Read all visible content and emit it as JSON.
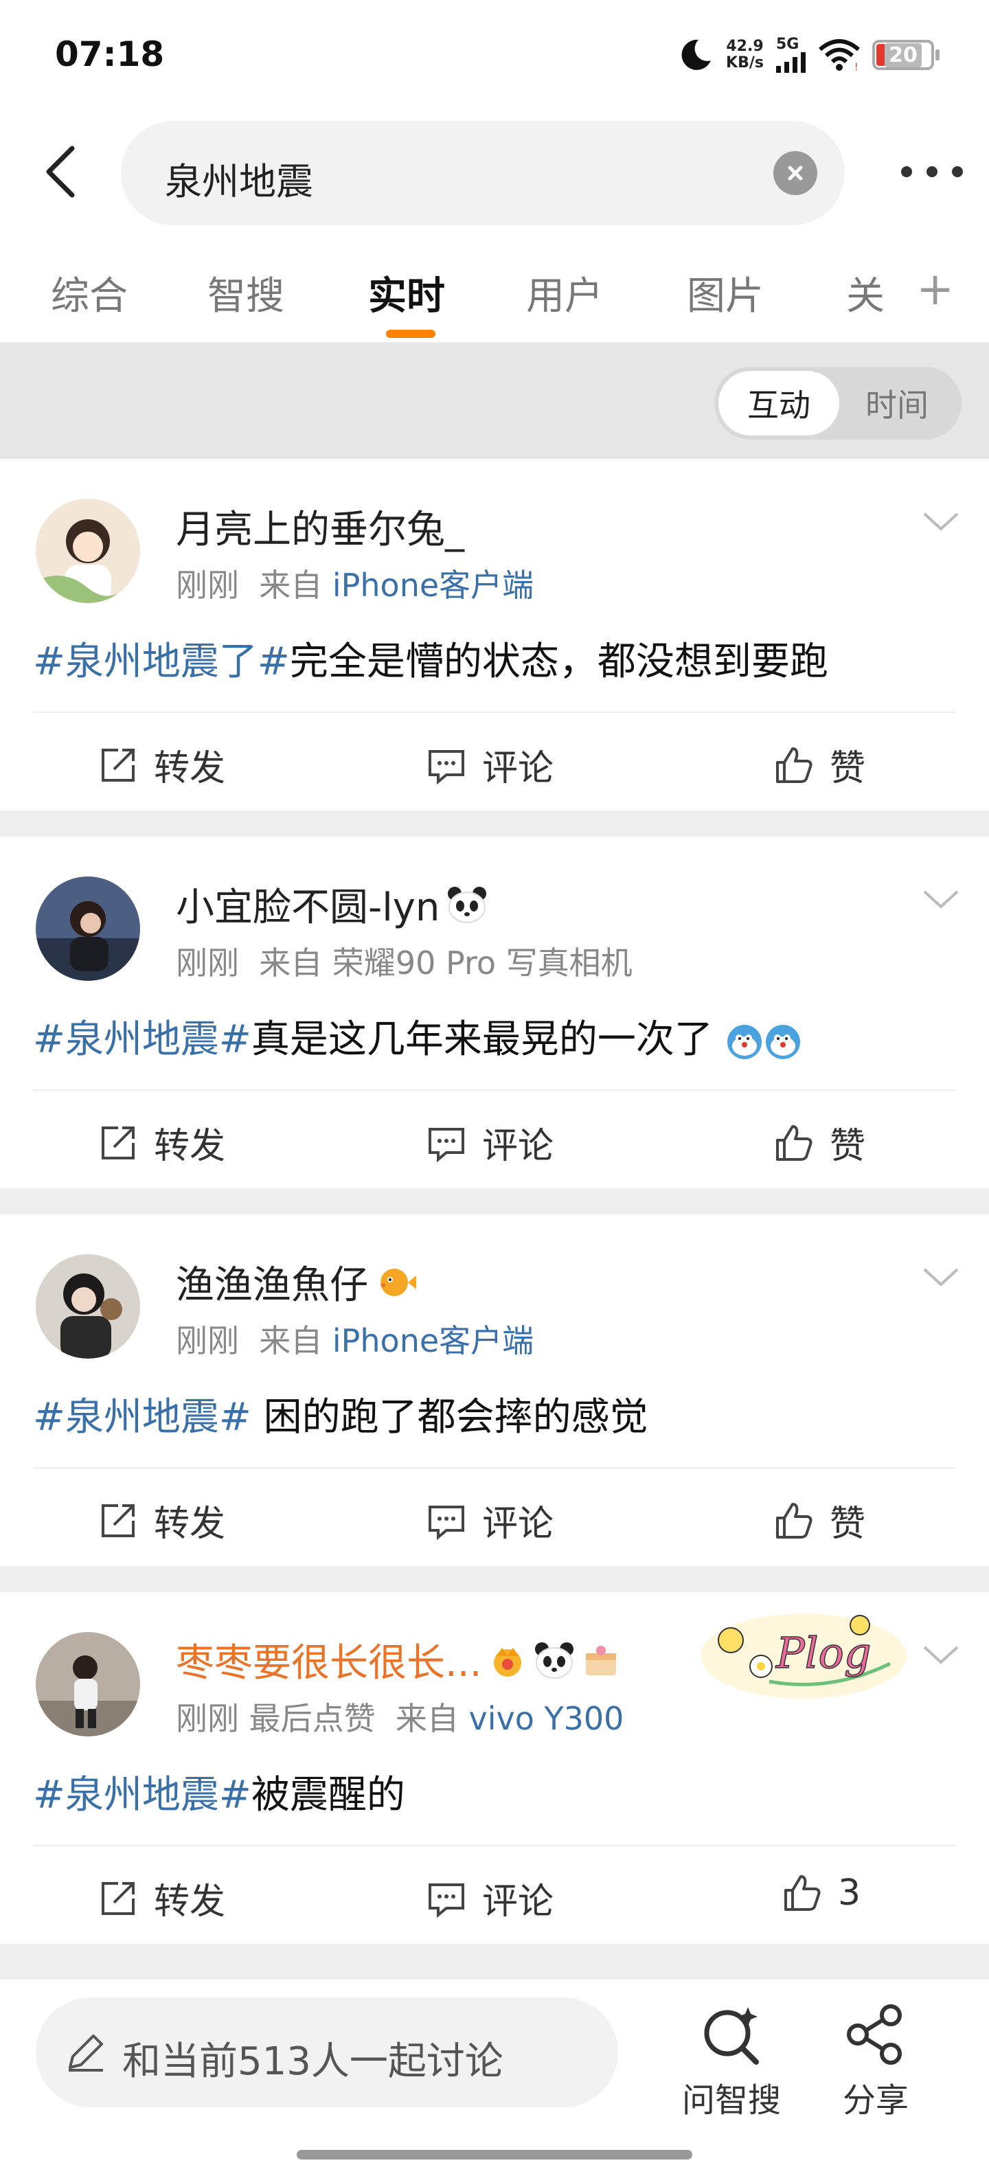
{
  "status": {
    "time": "07:18",
    "net_speed_value": "42.9",
    "net_speed_unit": "KB/s",
    "network": "5G",
    "battery": "20"
  },
  "search": {
    "query": "泉州地震"
  },
  "tabs": [
    {
      "label": "综合"
    },
    {
      "label": "智搜"
    },
    {
      "label": "实时"
    },
    {
      "label": "用户"
    },
    {
      "label": "图片"
    },
    {
      "label": "关"
    }
  ],
  "filter": {
    "option_on": "互动",
    "option_off": "时间"
  },
  "posts": [
    {
      "username": "月亮上的垂尔兔_",
      "time": "刚刚",
      "extra": "",
      "from_label": "来自",
      "source": "iPhone客户端",
      "tag": "#泉州地震了#",
      "text": "完全是懵的状态，都没想到要跑",
      "like_label": "赞"
    },
    {
      "username": "小宜脸不圆-lyn",
      "time": "刚刚",
      "extra": "",
      "from_label": "来自",
      "source": "荣耀90 Pro 写真相机",
      "tag": "#泉州地震#",
      "text": "真是这几年来最晃的一次了",
      "like_label": "赞"
    },
    {
      "username": "渔渔渔魚仔",
      "time": "刚刚",
      "extra": "",
      "from_label": "来自",
      "source": "iPhone客户端",
      "tag": "#泉州地震#",
      "text": " 困的跑了都会摔的感觉",
      "like_label": "赞"
    },
    {
      "username": "枣枣要很长很长...",
      "time": "刚刚",
      "extra": "最后点赞",
      "from_label": "来自",
      "source": "vivo Y300",
      "tag": "#泉州地震#",
      "text": "被震醒的",
      "like_label": "3"
    }
  ],
  "actions": {
    "repost": "转发",
    "comment": "评论"
  },
  "bottom": {
    "discuss_placeholder": "和当前513人一起讨论",
    "ask_label": "问智搜",
    "share_label": "分享"
  },
  "decor": {
    "plog": "Plog"
  }
}
